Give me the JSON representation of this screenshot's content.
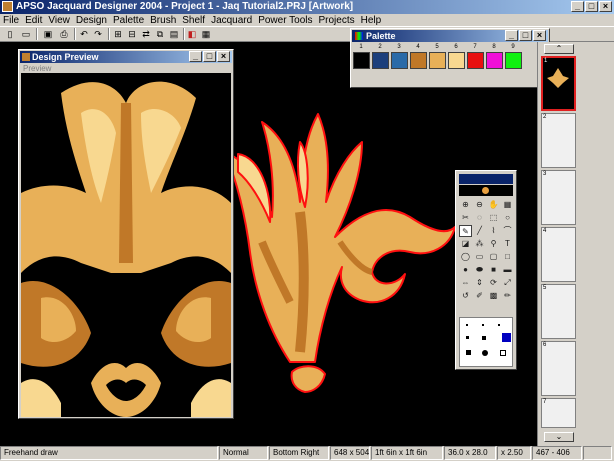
{
  "window": {
    "title": "APSO Jacquard Designer 2004 - Project 1 - Jaq Tutorial2.PRJ [Artwork]"
  },
  "menu": [
    "File",
    "Edit",
    "View",
    "Design",
    "Palette",
    "Brush",
    "Shelf",
    "Jacquard",
    "Power Tools",
    "Projects",
    "Help"
  ],
  "preview": {
    "title": "Design Preview",
    "menu": "Preview"
  },
  "palette": {
    "title": "Palette",
    "numbers": [
      "1",
      "2",
      "3",
      "4",
      "5",
      "6",
      "7",
      "8",
      "9"
    ],
    "colors": [
      "#000000",
      "#1c3f7c",
      "#2a6aa8",
      "#c07828",
      "#e8b058",
      "#f8d890",
      "#e81010",
      "#f010d8",
      "#10f010"
    ]
  },
  "pages": [
    "1",
    "2",
    "3",
    "4",
    "5",
    "6",
    "7"
  ],
  "status": {
    "tool": "Freehand draw",
    "mode": "Normal",
    "anchor": "Bottom Right",
    "size": "648 x 504",
    "dims": "1ft 6in x  1ft 6in",
    "units": "36.0 x 28.0",
    "zoom": "x 2.50",
    "coords": "467 - 406"
  }
}
